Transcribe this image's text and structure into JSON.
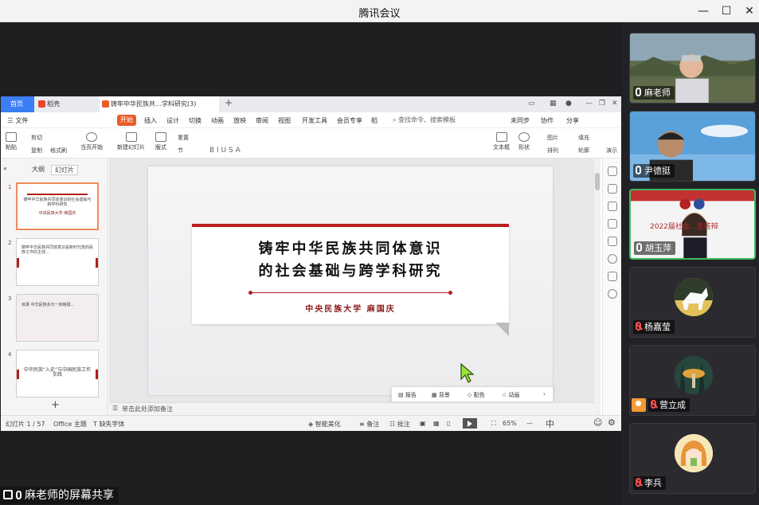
{
  "app": {
    "title": "腾讯会议"
  },
  "window_controls": [
    "—",
    "☐",
    "✕"
  ],
  "wps": {
    "tabs": {
      "home": "首页",
      "docer": "稻壳",
      "doc": "铸牢中华民族共…学科研究(3)"
    },
    "menu": [
      "三 文件",
      "开始",
      "插入",
      "设计",
      "切换",
      "动画",
      "放映",
      "审阅",
      "视图",
      "开发工具",
      "会员专享",
      "稻"
    ],
    "search": "查找命令、搜索模板",
    "menu_right": [
      "未同步",
      "协作",
      "分享"
    ],
    "toolbar": [
      "粘贴",
      "剪切",
      "复制",
      "格式刷",
      "当页开始",
      "新建幻灯片",
      "版式",
      "节",
      "重置",
      "文本框",
      "形状",
      "排列",
      "图片",
      "填充",
      "轮廓",
      "演示"
    ],
    "thumb_tabs": {
      "outline": "大纲",
      "slides": "幻灯片"
    },
    "thumbs": [
      {
        "no": "1",
        "text": "铸牢中华民族共同体意识的社会基础与跨学科研究",
        "sub": "中央民族大学 麻国庆"
      },
      {
        "no": "2",
        "text": "铸牢中华民族共同体意识是新时代党的民族工作的主线…"
      },
      {
        "no": "3",
        "text": "目录 中华民族多元一体格局…"
      },
      {
        "no": "4",
        "text": "中华民族“入史”与中国民族工作实践"
      }
    ],
    "slide": {
      "title_line1": "铸牢中华民族共同体意识",
      "title_line2": "的社会基础与跨学科研究",
      "author": "中央民族大学 麻国庆"
    },
    "float_bar": [
      "报告",
      "背景",
      "配色",
      "动画"
    ],
    "notes": "单击此处添加备注",
    "status": {
      "slide_count": "幻灯片 1 / 57",
      "theme": "Office 主题",
      "font_missing": "缺失字体",
      "beautify": "智能美化",
      "notes_btn": "备注",
      "comment": "批注",
      "zoom": "65%"
    }
  },
  "share_label": "麻老师的屏幕共享",
  "participants": [
    {
      "name": "麻老师",
      "muted": false,
      "video": true
    },
    {
      "name": "尹德挺",
      "muted": false,
      "video": true
    },
    {
      "name": "胡玉萍",
      "muted": false,
      "video": true,
      "active": true,
      "banner": "2022届社会…生答辩"
    },
    {
      "name": "杨嘉莹",
      "muted": true,
      "video": false
    },
    {
      "name": "营立成",
      "muted": true,
      "video": false,
      "host": true
    },
    {
      "name": "李兵",
      "muted": true,
      "video": false
    }
  ],
  "colors": {
    "accent_red": "#b91e1e",
    "wps_blue": "#3c7ef3",
    "speaking_green": "#3dbb5e"
  }
}
